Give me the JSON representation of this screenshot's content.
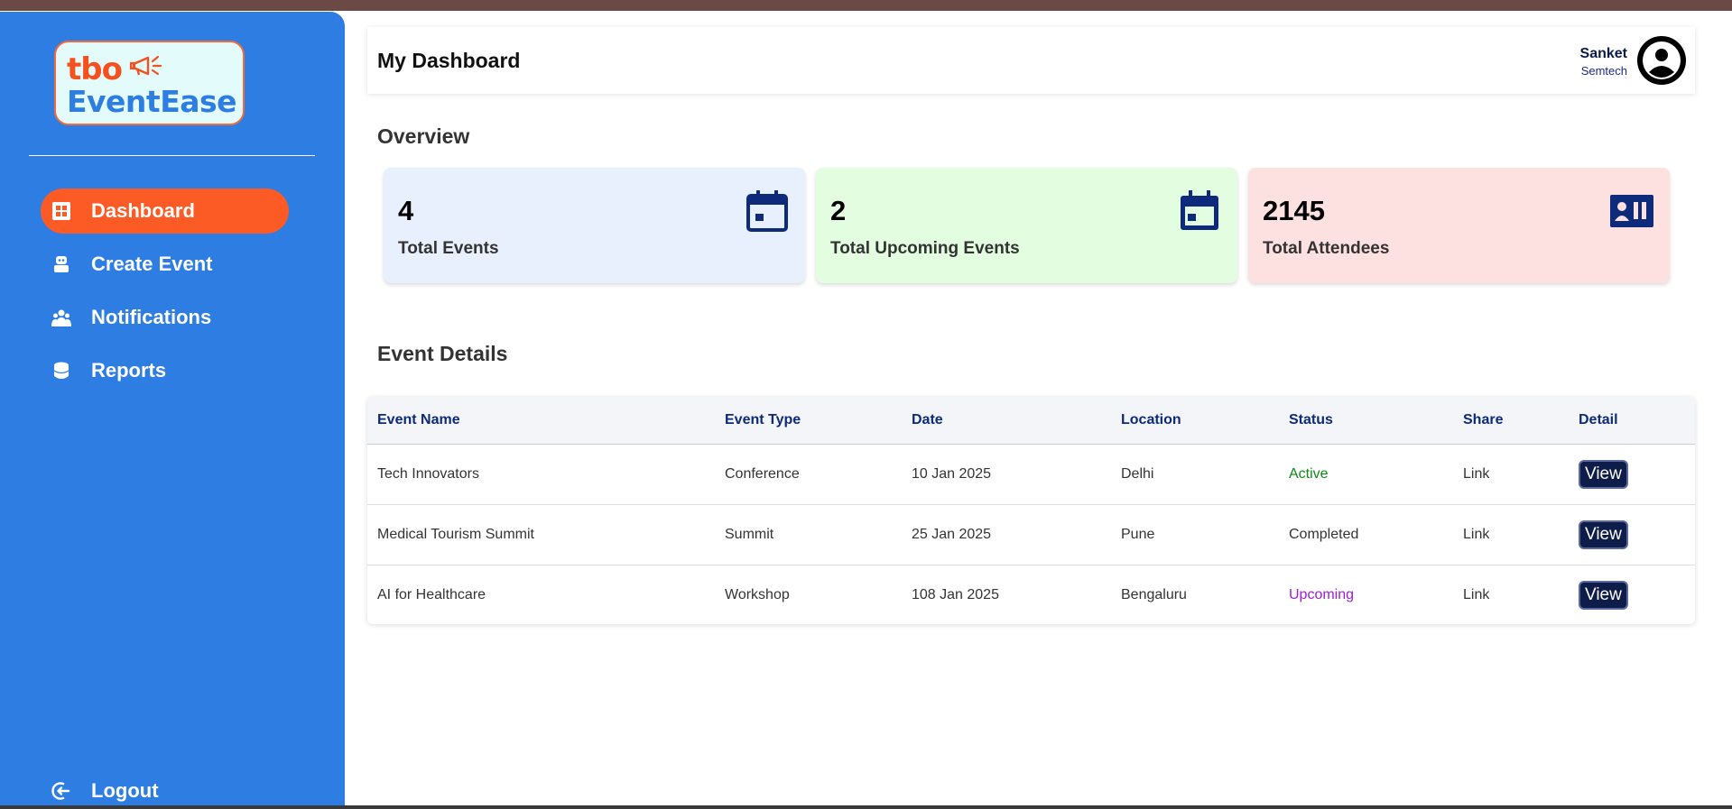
{
  "brand": {
    "logo_top": "tbo",
    "logo_name": "EventEase"
  },
  "sidebar": {
    "items": [
      {
        "label": "Dashboard",
        "icon": "grid-icon",
        "active": true
      },
      {
        "label": "Create Event",
        "icon": "robot-icon",
        "active": false
      },
      {
        "label": "Notifications",
        "icon": "users-icon",
        "active": false
      },
      {
        "label": "Reports",
        "icon": "database-icon",
        "active": false
      }
    ],
    "logout_label": "Logout"
  },
  "header": {
    "title": "My Dashboard",
    "user_name": "Sanket",
    "user_org": "Semtech"
  },
  "overview": {
    "title": "Overview",
    "cards": [
      {
        "value": "4",
        "label": "Total Events",
        "icon": "calendar-icon",
        "bg": "#e8f0fd"
      },
      {
        "value": "2",
        "label": "Total Upcoming Events",
        "icon": "calendar-filled-icon",
        "bg": "#e3fde0"
      },
      {
        "value": "2145",
        "label": "Total Attendees",
        "icon": "id-card-icon",
        "bg": "#fde1e1"
      }
    ]
  },
  "events": {
    "title": "Event Details",
    "columns": [
      "Event Name",
      "Event Type",
      "Date",
      "Location",
      "Status",
      "Share",
      "Detail"
    ],
    "rows": [
      {
        "name": "Tech Innovators",
        "type": "Conference",
        "date": "10 Jan 2025",
        "location": "Delhi",
        "status": "Active",
        "status_color": "#0e8a16",
        "share": "Link",
        "detail": "View"
      },
      {
        "name": "Medical Tourism Summit",
        "type": "Summit",
        "date": "25 Jan 2025",
        "location": "Pune",
        "status": "Completed",
        "status_color": "#333333",
        "share": "Link",
        "detail": "View"
      },
      {
        "name": "AI for Healthcare",
        "type": "Workshop",
        "date": "108 Jan 2025",
        "location": "Bengaluru",
        "status": "Upcoming",
        "status_color": "#9b1fd6",
        "share": "Link",
        "detail": "View"
      }
    ]
  },
  "colors": {
    "sidebar_bg": "#2e7de3",
    "active_item": "#fc5b25",
    "header_text": "#0e2a7a"
  }
}
